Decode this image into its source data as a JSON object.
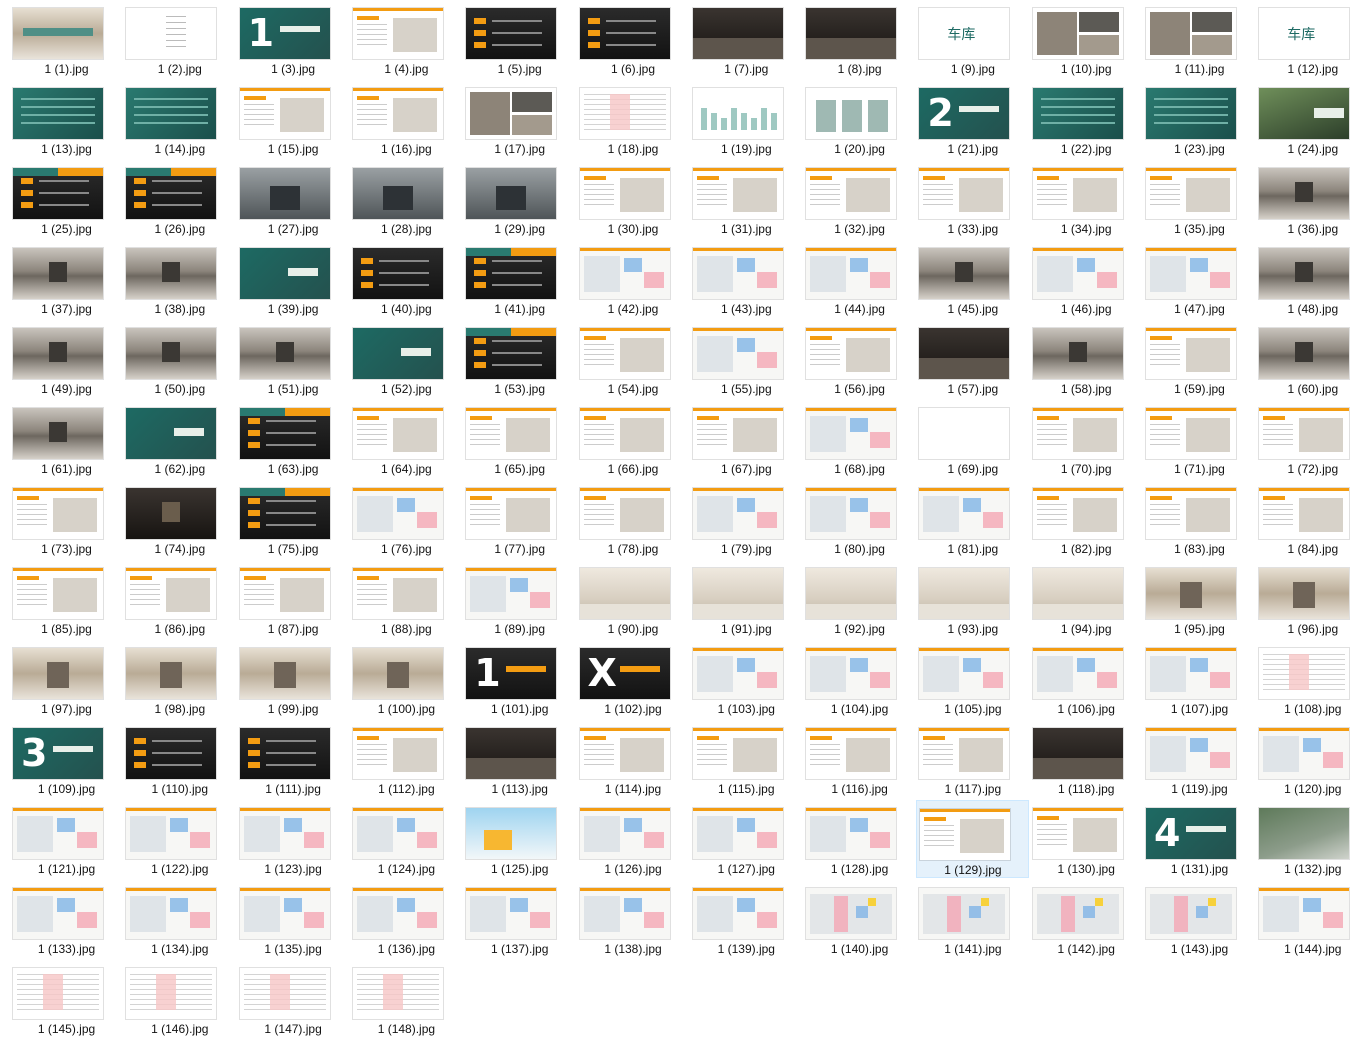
{
  "files": [
    {
      "name": "1 (1).jpg",
      "style": "banner"
    },
    {
      "name": "1 (2).jpg",
      "style": "toc"
    },
    {
      "name": "1 (3).jpg",
      "style": "section",
      "num": "1"
    },
    {
      "name": "1 (4).jpg",
      "style": "doc"
    },
    {
      "name": "1 (5).jpg",
      "style": "darkinfo",
      "words": "成本 客户 分析"
    },
    {
      "name": "1 (6).jpg",
      "style": "dark"
    },
    {
      "name": "1 (7).jpg",
      "style": "photo-dark"
    },
    {
      "name": "1 (8).jpg",
      "style": "photo-dark"
    },
    {
      "name": "1 (9).jpg",
      "style": "wordcloud",
      "word": "车库"
    },
    {
      "name": "1 (10).jpg",
      "style": "collage"
    },
    {
      "name": "1 (11).jpg",
      "style": "collage"
    },
    {
      "name": "1 (12).jpg",
      "style": "wordcloud",
      "word": "车库"
    },
    {
      "name": "1 (13).jpg",
      "style": "teal"
    },
    {
      "name": "1 (14).jpg",
      "style": "teal"
    },
    {
      "name": "1 (15).jpg",
      "style": "doc"
    },
    {
      "name": "1 (16).jpg",
      "style": "doc"
    },
    {
      "name": "1 (17).jpg",
      "style": "collage"
    },
    {
      "name": "1 (18).jpg",
      "style": "table"
    },
    {
      "name": "1 (19).jpg",
      "style": "bars"
    },
    {
      "name": "1 (20).jpg",
      "style": "pills"
    },
    {
      "name": "1 (21).jpg",
      "style": "section",
      "num": "2"
    },
    {
      "name": "1 (22).jpg",
      "style": "teal"
    },
    {
      "name": "1 (23).jpg",
      "style": "teal"
    },
    {
      "name": "1 (24).jpg",
      "style": "entry"
    },
    {
      "name": "1 (25).jpg",
      "style": "split"
    },
    {
      "name": "1 (26).jpg",
      "style": "split"
    },
    {
      "name": "1 (27).jpg",
      "style": "facade"
    },
    {
      "name": "1 (28).jpg",
      "style": "facade"
    },
    {
      "name": "1 (29).jpg",
      "style": "facade"
    },
    {
      "name": "1 (30).jpg",
      "style": "doc"
    },
    {
      "name": "1 (31).jpg",
      "style": "doc"
    },
    {
      "name": "1 (32).jpg",
      "style": "doc"
    },
    {
      "name": "1 (33).jpg",
      "style": "doc"
    },
    {
      "name": "1 (34).jpg",
      "style": "doc"
    },
    {
      "name": "1 (35).jpg",
      "style": "doc"
    },
    {
      "name": "1 (36).jpg",
      "style": "tunnel"
    },
    {
      "name": "1 (37).jpg",
      "style": "tunnel"
    },
    {
      "name": "1 (38).jpg",
      "style": "tunnel"
    },
    {
      "name": "1 (39).jpg",
      "style": "teal-title"
    },
    {
      "name": "1 (40).jpg",
      "style": "dark"
    },
    {
      "name": "1 (41).jpg",
      "style": "split"
    },
    {
      "name": "1 (42).jpg",
      "style": "plan"
    },
    {
      "name": "1 (43).jpg",
      "style": "plan"
    },
    {
      "name": "1 (44).jpg",
      "style": "plan"
    },
    {
      "name": "1 (45).jpg",
      "style": "tunnel"
    },
    {
      "name": "1 (46).jpg",
      "style": "plan"
    },
    {
      "name": "1 (47).jpg",
      "style": "plan"
    },
    {
      "name": "1 (48).jpg",
      "style": "tunnel"
    },
    {
      "name": "1 (49).jpg",
      "style": "tunnel"
    },
    {
      "name": "1 (50).jpg",
      "style": "tunnel"
    },
    {
      "name": "1 (51).jpg",
      "style": "tunnel"
    },
    {
      "name": "1 (52).jpg",
      "style": "teal-title"
    },
    {
      "name": "1 (53).jpg",
      "style": "split"
    },
    {
      "name": "1 (54).jpg",
      "style": "doc"
    },
    {
      "name": "1 (55).jpg",
      "style": "plan"
    },
    {
      "name": "1 (56).jpg",
      "style": "doc"
    },
    {
      "name": "1 (57).jpg",
      "style": "photo-dark"
    },
    {
      "name": "1 (58).jpg",
      "style": "tunnel"
    },
    {
      "name": "1 (59).jpg",
      "style": "doc"
    },
    {
      "name": "1 (60).jpg",
      "style": "tunnel"
    },
    {
      "name": "1 (61).jpg",
      "style": "tunnel"
    },
    {
      "name": "1 (62).jpg",
      "style": "teal-title"
    },
    {
      "name": "1 (63).jpg",
      "style": "split"
    },
    {
      "name": "1 (64).jpg",
      "style": "doc"
    },
    {
      "name": "1 (65).jpg",
      "style": "doc"
    },
    {
      "name": "1 (66).jpg",
      "style": "doc"
    },
    {
      "name": "1 (67).jpg",
      "style": "doc"
    },
    {
      "name": "1 (68).jpg",
      "style": "plan"
    },
    {
      "name": "1 (69).jpg",
      "style": "photo-green"
    },
    {
      "name": "1 (70).jpg",
      "style": "doc"
    },
    {
      "name": "1 (71).jpg",
      "style": "doc"
    },
    {
      "name": "1 (72).jpg",
      "style": "doc"
    },
    {
      "name": "1 (73).jpg",
      "style": "doc"
    },
    {
      "name": "1 (74).jpg",
      "style": "tunnel-dark"
    },
    {
      "name": "1 (75).jpg",
      "style": "split"
    },
    {
      "name": "1 (76).jpg",
      "style": "plan"
    },
    {
      "name": "1 (77).jpg",
      "style": "doc"
    },
    {
      "name": "1 (78).jpg",
      "style": "doc"
    },
    {
      "name": "1 (79).jpg",
      "style": "plan"
    },
    {
      "name": "1 (80).jpg",
      "style": "plan"
    },
    {
      "name": "1 (81).jpg",
      "style": "plan"
    },
    {
      "name": "1 (82).jpg",
      "style": "doc"
    },
    {
      "name": "1 (83).jpg",
      "style": "doc"
    },
    {
      "name": "1 (84).jpg",
      "style": "doc"
    },
    {
      "name": "1 (85).jpg",
      "style": "doc"
    },
    {
      "name": "1 (86).jpg",
      "style": "doc"
    },
    {
      "name": "1 (87).jpg",
      "style": "doc"
    },
    {
      "name": "1 (88).jpg",
      "style": "doc"
    },
    {
      "name": "1 (89).jpg",
      "style": "plan"
    },
    {
      "name": "1 (90).jpg",
      "style": "lobby"
    },
    {
      "name": "1 (91).jpg",
      "style": "lobby"
    },
    {
      "name": "1 (92).jpg",
      "style": "lobby"
    },
    {
      "name": "1 (93).jpg",
      "style": "lobby"
    },
    {
      "name": "1 (94).jpg",
      "style": "lobby"
    },
    {
      "name": "1 (95).jpg",
      "style": "lobby2"
    },
    {
      "name": "1 (96).jpg",
      "style": "lobby2"
    },
    {
      "name": "1 (97).jpg",
      "style": "lobby2"
    },
    {
      "name": "1 (98).jpg",
      "style": "lobby2"
    },
    {
      "name": "1 (99).jpg",
      "style": "lobby2"
    },
    {
      "name": "1 (100).jpg",
      "style": "lobby2"
    },
    {
      "name": "1 (101).jpg",
      "style": "section-dark",
      "num": "1"
    },
    {
      "name": "1 (102).jpg",
      "style": "section-dark",
      "num": "X"
    },
    {
      "name": "1 (103).jpg",
      "style": "plan"
    },
    {
      "name": "1 (104).jpg",
      "style": "plan"
    },
    {
      "name": "1 (105).jpg",
      "style": "plan"
    },
    {
      "name": "1 (106).jpg",
      "style": "plan"
    },
    {
      "name": "1 (107).jpg",
      "style": "plan"
    },
    {
      "name": "1 (108).jpg",
      "style": "table"
    },
    {
      "name": "1 (109).jpg",
      "style": "section",
      "num": "3"
    },
    {
      "name": "1 (110).jpg",
      "style": "dark"
    },
    {
      "name": "1 (111).jpg",
      "style": "dark"
    },
    {
      "name": "1 (112).jpg",
      "style": "doc"
    },
    {
      "name": "1 (113).jpg",
      "style": "photo-dark"
    },
    {
      "name": "1 (114).jpg",
      "style": "doc"
    },
    {
      "name": "1 (115).jpg",
      "style": "doc"
    },
    {
      "name": "1 (116).jpg",
      "style": "doc"
    },
    {
      "name": "1 (117).jpg",
      "style": "doc"
    },
    {
      "name": "1 (118).jpg",
      "style": "photo-dark"
    },
    {
      "name": "1 (119).jpg",
      "style": "plan"
    },
    {
      "name": "1 (120).jpg",
      "style": "plan"
    },
    {
      "name": "1 (121).jpg",
      "style": "plan"
    },
    {
      "name": "1 (122).jpg",
      "style": "plan"
    },
    {
      "name": "1 (123).jpg",
      "style": "plan"
    },
    {
      "name": "1 (124).jpg",
      "style": "plan"
    },
    {
      "name": "1 (125).jpg",
      "style": "illus"
    },
    {
      "name": "1 (126).jpg",
      "style": "plan"
    },
    {
      "name": "1 (127).jpg",
      "style": "plan"
    },
    {
      "name": "1 (128).jpg",
      "style": "plan"
    },
    {
      "name": "1 (129).jpg",
      "style": "doc",
      "selected": true
    },
    {
      "name": "1 (130).jpg",
      "style": "doc"
    },
    {
      "name": "1 (131).jpg",
      "style": "section",
      "num": "4"
    },
    {
      "name": "1 (132).jpg",
      "style": "aerial"
    },
    {
      "name": "1 (133).jpg",
      "style": "plan"
    },
    {
      "name": "1 (134).jpg",
      "style": "plan"
    },
    {
      "name": "1 (135).jpg",
      "style": "plan"
    },
    {
      "name": "1 (136).jpg",
      "style": "plan"
    },
    {
      "name": "1 (137).jpg",
      "style": "plan"
    },
    {
      "name": "1 (138).jpg",
      "style": "plan"
    },
    {
      "name": "1 (139).jpg",
      "style": "plan"
    },
    {
      "name": "1 (140).jpg",
      "style": "plan-color"
    },
    {
      "name": "1 (141).jpg",
      "style": "plan-color"
    },
    {
      "name": "1 (142).jpg",
      "style": "plan-color"
    },
    {
      "name": "1 (143).jpg",
      "style": "plan-color"
    },
    {
      "name": "1 (144).jpg",
      "style": "plan"
    },
    {
      "name": "1 (145).jpg",
      "style": "table"
    },
    {
      "name": "1 (146).jpg",
      "style": "table"
    },
    {
      "name": "1 (147).jpg",
      "style": "table"
    },
    {
      "name": "1 (148).jpg",
      "style": "table"
    }
  ],
  "selected_color": "#e5f1fb",
  "accent_orange": "#f39c12",
  "accent_teal": "#1d6a63"
}
